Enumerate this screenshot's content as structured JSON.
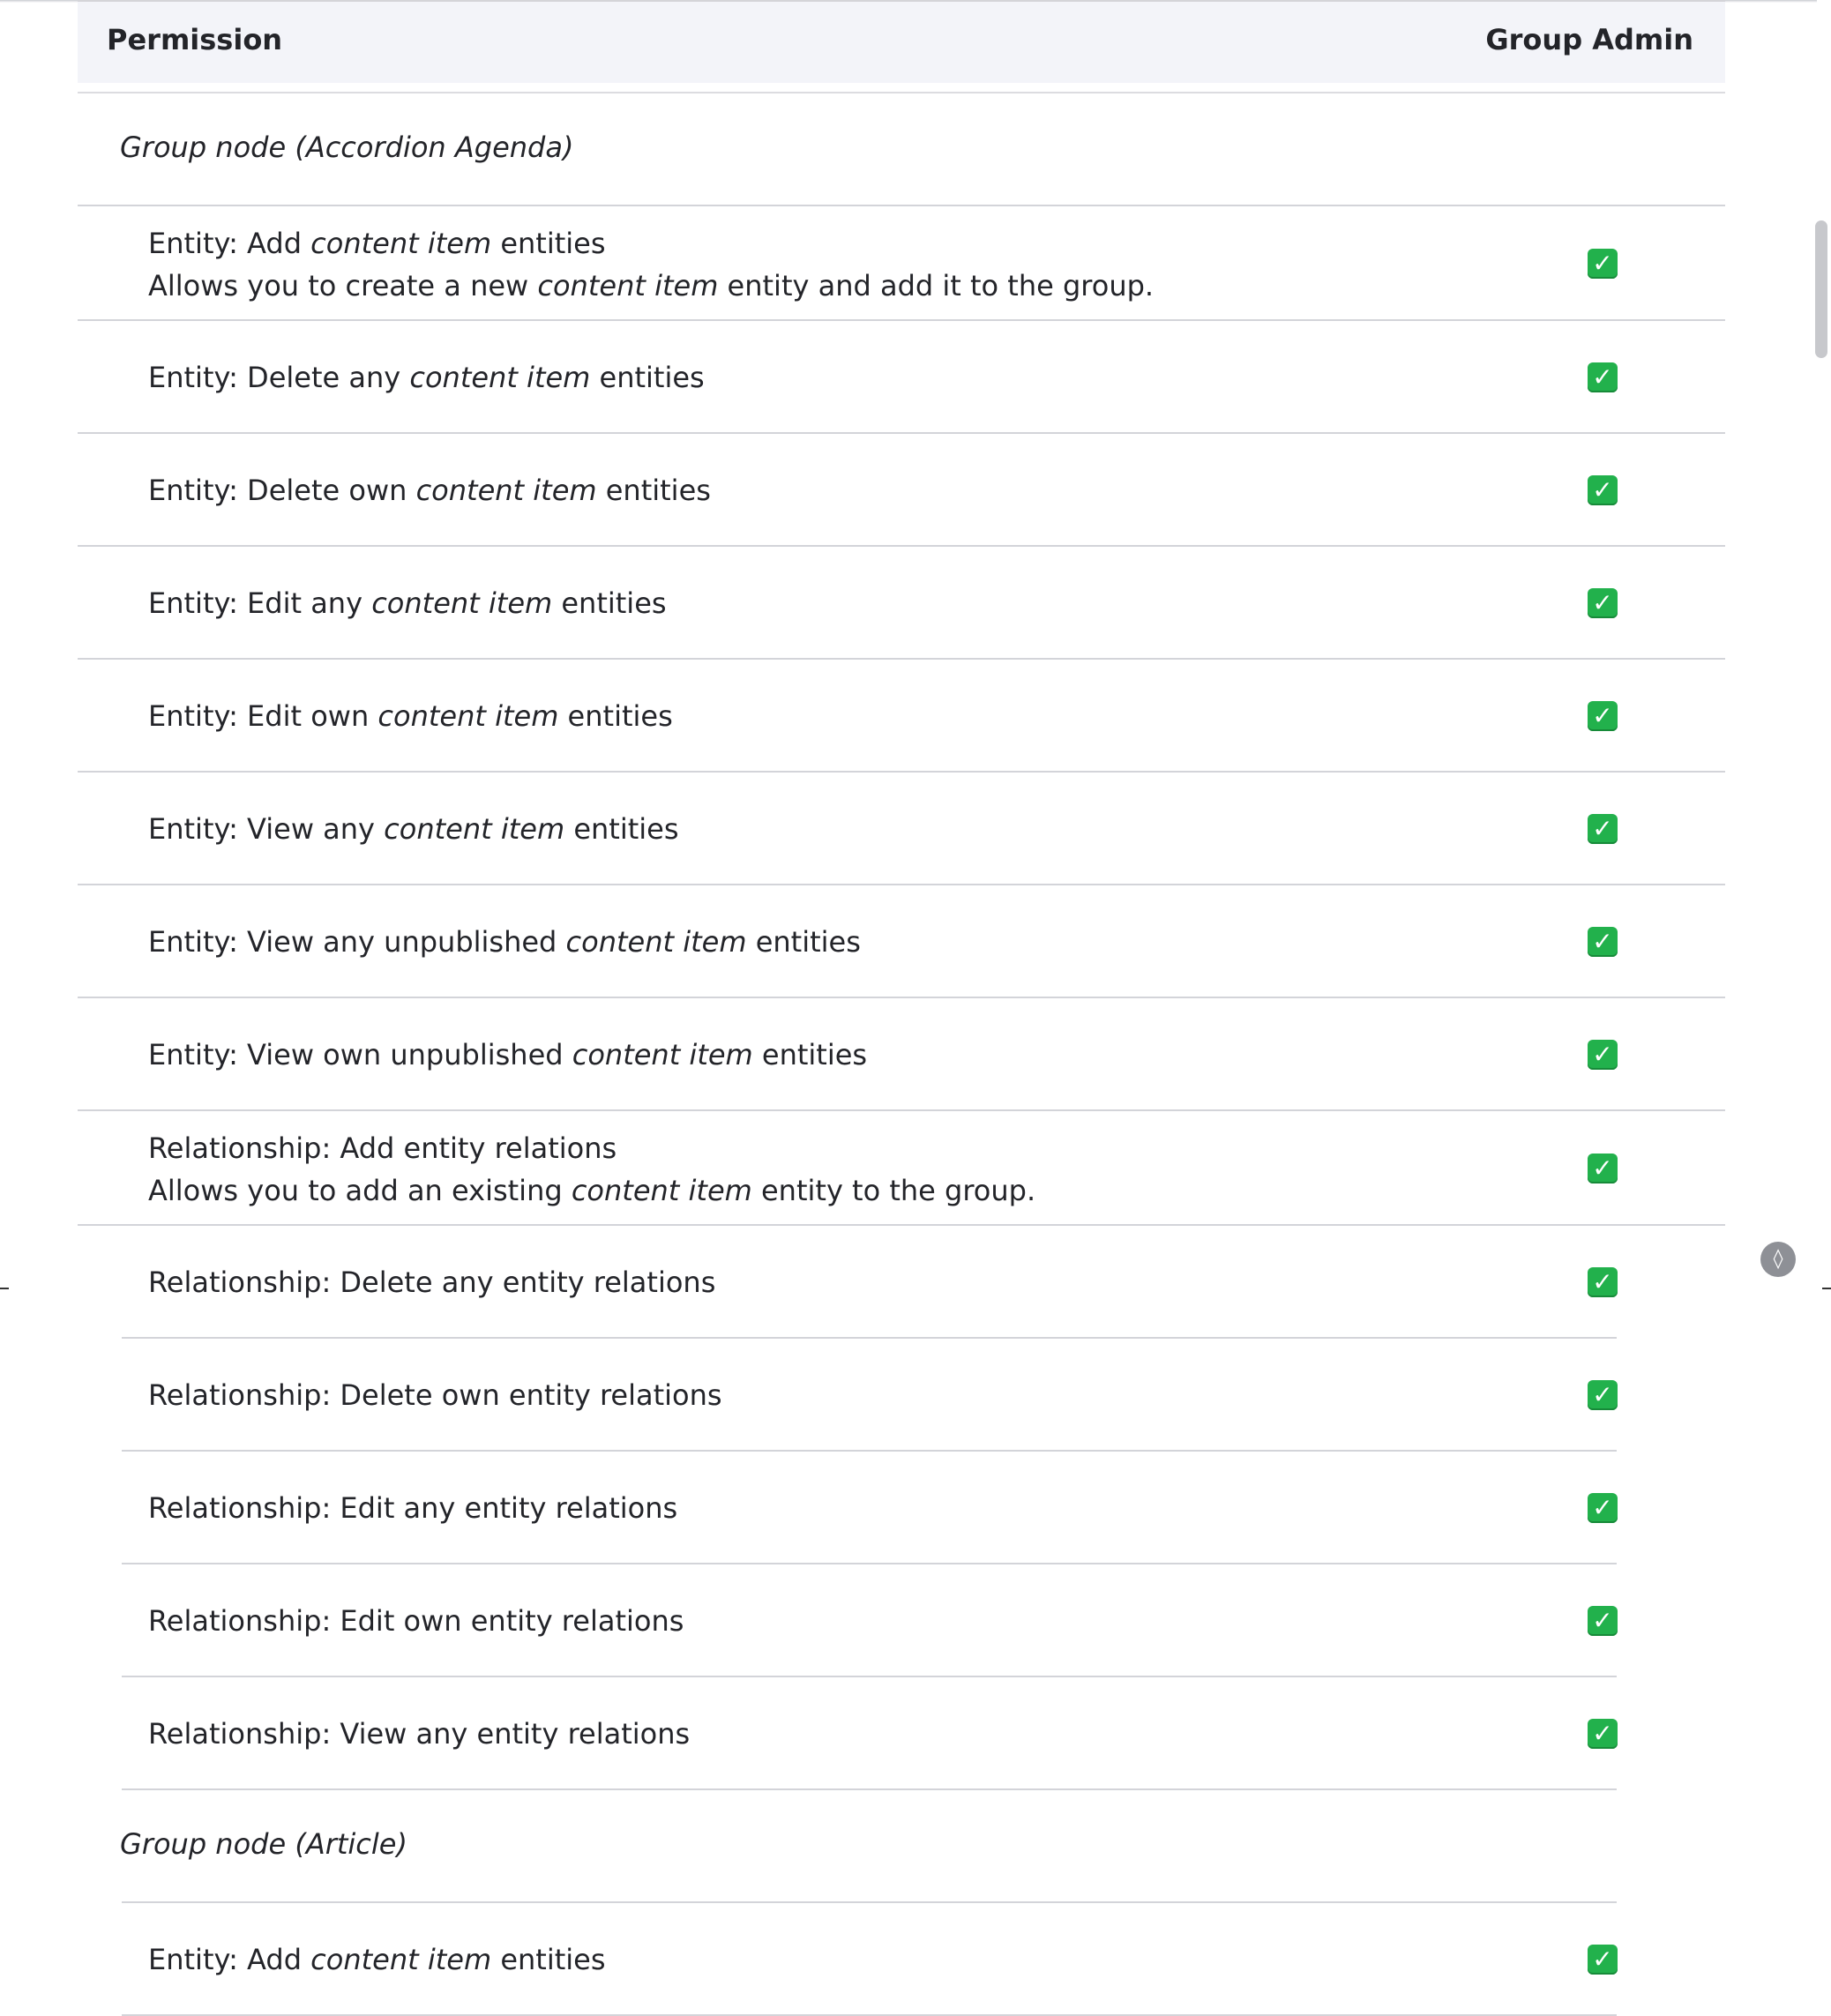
{
  "header": {
    "permission_col": "Permission",
    "role_col": "Group Admin"
  },
  "groups": [
    {
      "label": "Group node (Accordion Agenda)",
      "rows": [
        {
          "pre": "Entity: Add ",
          "em": "content item",
          "post": " entities",
          "desc_pre": "Allows you to create a new ",
          "desc_em": "content item",
          "desc_post": " entity and add it to the group.",
          "checked": true
        },
        {
          "pre": "Entity: Delete any ",
          "em": "content item",
          "post": " entities",
          "checked": true
        },
        {
          "pre": "Entity: Delete own ",
          "em": "content item",
          "post": " entities",
          "checked": true
        },
        {
          "pre": "Entity: Edit any ",
          "em": "content item",
          "post": " entities",
          "checked": true
        },
        {
          "pre": "Entity: Edit own ",
          "em": "content item",
          "post": " entities",
          "checked": true
        },
        {
          "pre": "Entity: View any ",
          "em": "content item",
          "post": " entities",
          "checked": true
        },
        {
          "pre": "Entity: View any unpublished ",
          "em": "content item",
          "post": " entities",
          "checked": true
        },
        {
          "pre": "Entity: View own unpublished ",
          "em": "content item",
          "post": " entities",
          "checked": true
        },
        {
          "pre": "Relationship: Add entity relations",
          "em": "",
          "post": "",
          "desc_pre": "Allows you to add an existing ",
          "desc_em": "content item",
          "desc_post": " entity to the group.",
          "checked": true
        },
        {
          "pre": "Relationship: Delete any entity relations",
          "em": "",
          "post": "",
          "checked": true
        },
        {
          "pre": "Relationship: Delete own entity relations",
          "em": "",
          "post": "",
          "checked": true
        },
        {
          "pre": "Relationship: Edit any entity relations",
          "em": "",
          "post": "",
          "checked": true
        },
        {
          "pre": "Relationship: Edit own entity relations",
          "em": "",
          "post": "",
          "checked": true
        },
        {
          "pre": "Relationship: View any entity relations",
          "em": "",
          "post": "",
          "checked": true
        }
      ]
    },
    {
      "label": "Group node (Article)",
      "rows": [
        {
          "pre": "Entity: Add ",
          "em": "content item",
          "post": " entities",
          "checked": true
        }
      ]
    }
  ],
  "check_glyph": "✓",
  "icons": {
    "checkbox": "checkbox-checked-icon",
    "drupal": "drupal-drop-icon"
  }
}
